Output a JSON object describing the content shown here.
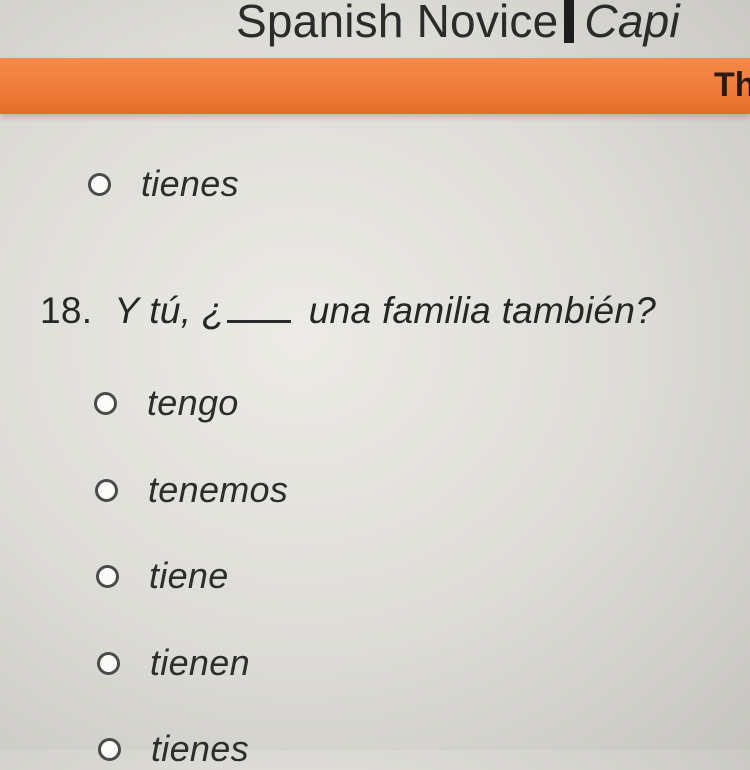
{
  "header": {
    "title": "Spanish Novice",
    "subtitle": "Capi",
    "corner_text": "Th"
  },
  "previous_question": {
    "options": [
      {
        "label": "tienes"
      }
    ]
  },
  "question": {
    "number": "18.",
    "text_before_blank": "Y tú, ¿",
    "text_after_blank": "una familia también?",
    "options": [
      {
        "label": "tengo"
      },
      {
        "label": "tenemos"
      },
      {
        "label": "tiene"
      },
      {
        "label": "tienen"
      },
      {
        "label": "tienes"
      }
    ]
  },
  "colors": {
    "accent_orange": "#ef7a38",
    "background": "#e4e3de",
    "text": "#2a2a2a"
  }
}
